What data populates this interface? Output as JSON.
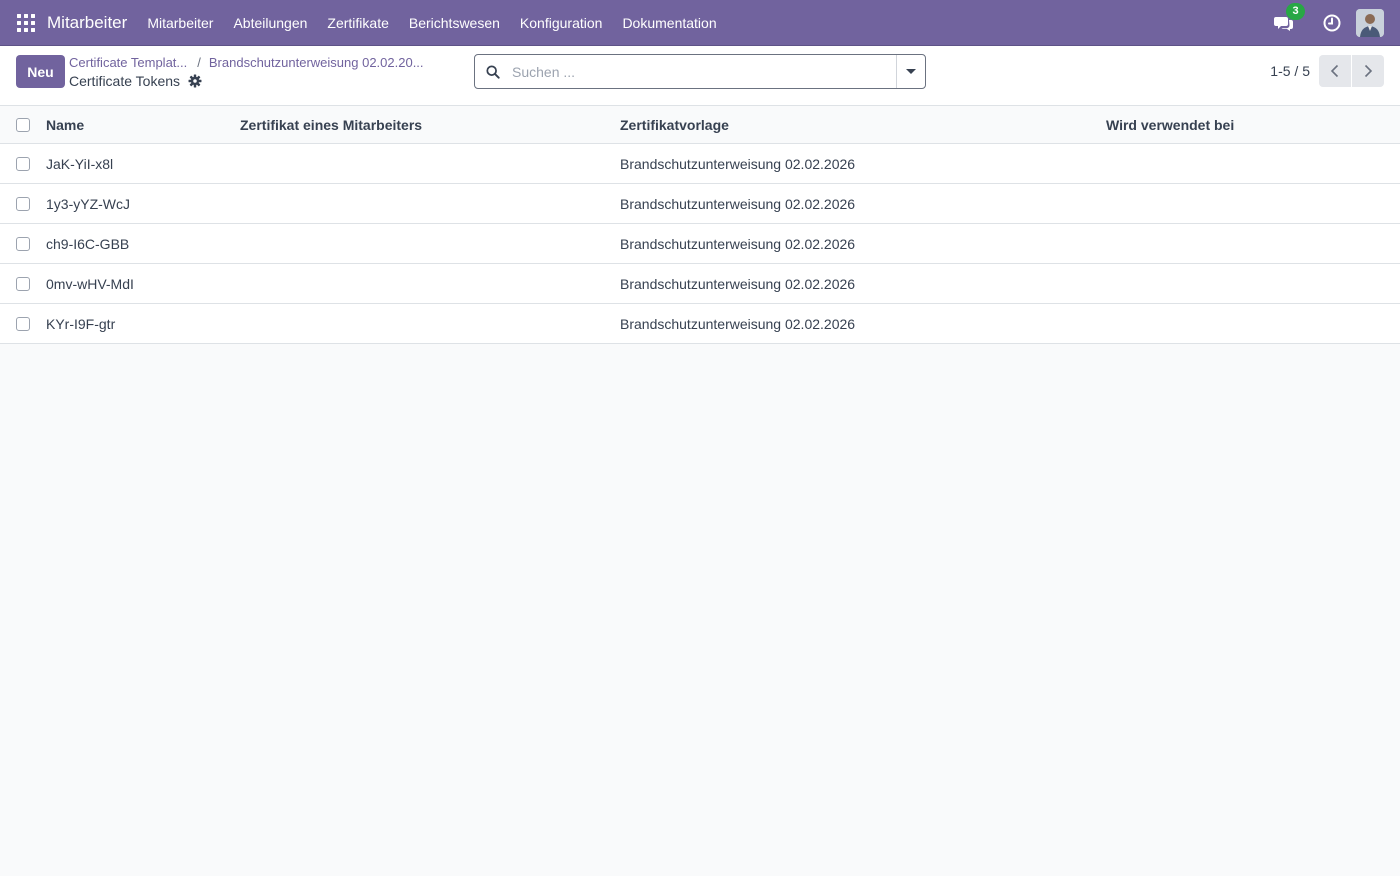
{
  "navbar": {
    "brand": "Mitarbeiter",
    "menu": [
      "Mitarbeiter",
      "Abteilungen",
      "Zertifikate",
      "Berichtswesen",
      "Konfiguration",
      "Dokumentation"
    ],
    "chat_badge": "3",
    "accent_color": "#71639e"
  },
  "control": {
    "new_label": "Neu",
    "breadcrumb": [
      "Certificate Templat...",
      "Brandschutzunterweisung 02.02.20..."
    ],
    "breadcrumb_separator": "/",
    "title": "Certificate Tokens",
    "search_placeholder": "Suchen ...",
    "pager": "1-5 / 5"
  },
  "table": {
    "columns": [
      "Name",
      "Zertifikat eines Mitarbeiters",
      "Zertifikatvorlage",
      "Wird verwendet bei"
    ],
    "rows": [
      {
        "name": "JaK-YiI-x8l",
        "cert": "",
        "template": "Brandschutzunterweisung 02.02.2026",
        "used": ""
      },
      {
        "name": "1y3-yYZ-WcJ",
        "cert": "",
        "template": "Brandschutzunterweisung 02.02.2026",
        "used": ""
      },
      {
        "name": "ch9-I6C-GBB",
        "cert": "",
        "template": "Brandschutzunterweisung 02.02.2026",
        "used": ""
      },
      {
        "name": "0mv-wHV-MdI",
        "cert": "",
        "template": "Brandschutzunterweisung 02.02.2026",
        "used": ""
      },
      {
        "name": "KYr-I9F-gtr",
        "cert": "",
        "template": "Brandschutzunterweisung 02.02.2026",
        "used": ""
      }
    ]
  }
}
